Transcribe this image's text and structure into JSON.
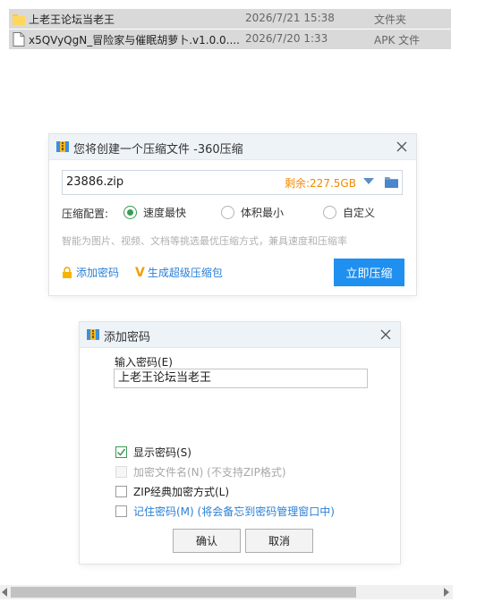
{
  "files": [
    {
      "name": "上老王论坛当老王",
      "date": "2026/7/21 15:38",
      "type": "文件夹",
      "icon": "folder-icon"
    },
    {
      "name": "x5QVyQgN_冒险家与催眠胡萝卜.v1.0.0....",
      "date": "2026/7/20 1:33",
      "type": "APK 文件",
      "icon": "file-icon"
    }
  ],
  "compress_dialog": {
    "title": "您将创建一个压缩文件 -360压缩",
    "zip_name": "23886.zip",
    "free_space": "剩余:227.5GB",
    "option_label": "压缩配置:",
    "options": [
      "速度最快",
      "体积最小",
      "自定义"
    ],
    "selected_option": "速度最快",
    "hint": "智能为图片、视频、文档等挑选最优压缩方式，兼具速度和压缩率",
    "add_password": "添加密码",
    "super_compress_v": "V",
    "super_compress": "生成超级压缩包",
    "compress_now": "立即压缩",
    "accent_color": "#1f8ff0",
    "free_space_color": "#f08a00"
  },
  "password_dialog": {
    "title": "添加密码",
    "enter_label": "输入密码(E)",
    "password_value": "上老王论坛当老王",
    "show_password": "显示密码(S)",
    "encrypt_filenames": "加密文件名(N) (不支持ZIP格式)",
    "zip_classic": "ZIP经典加密方式(L)",
    "remember_password": "记住密码(M) (将会备忘到密码管理窗口中)",
    "ok": "确认",
    "cancel": "取消"
  }
}
